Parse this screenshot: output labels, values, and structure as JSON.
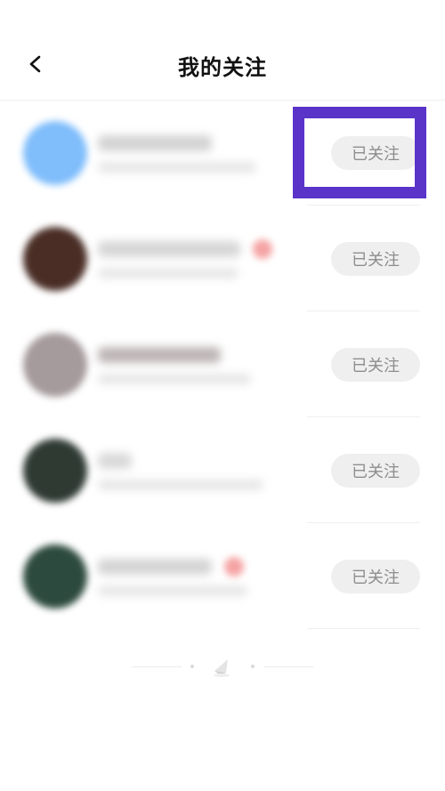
{
  "header": {
    "back_icon": "chevron-left-icon",
    "title": "我的关注"
  },
  "rows": [
    {
      "button_label": "已关注",
      "avatar_color": "#7fbdfb",
      "name_color": "#d3d3d3",
      "has_badge": false,
      "name_width": 128,
      "info_width": 178
    },
    {
      "button_label": "已关注",
      "avatar_color": "#4a2e26",
      "name_color": "#d6d6d6",
      "has_badge": true,
      "name_width": 160,
      "info_width": 158
    },
    {
      "button_label": "已关注",
      "avatar_color": "#a59a9c",
      "name_color": "#bdb5b5",
      "has_badge": false,
      "name_width": 138,
      "info_width": 172
    },
    {
      "button_label": "已关注",
      "avatar_color": "#2f3a33",
      "name_color": "#d9d9d9",
      "has_badge": false,
      "name_width": 38,
      "info_width": 186
    },
    {
      "button_label": "已关注",
      "avatar_color": "#2d4a3e",
      "name_color": "#d4d4d4",
      "has_badge": true,
      "name_width": 128,
      "info_width": 168
    }
  ],
  "colors": {
    "highlight": "#5a33c9",
    "button_bg": "#efefef",
    "button_text": "#8d8d8d",
    "badge": "#f5a3a3"
  },
  "footer": {
    "end_icon": "end-of-list-icon"
  }
}
